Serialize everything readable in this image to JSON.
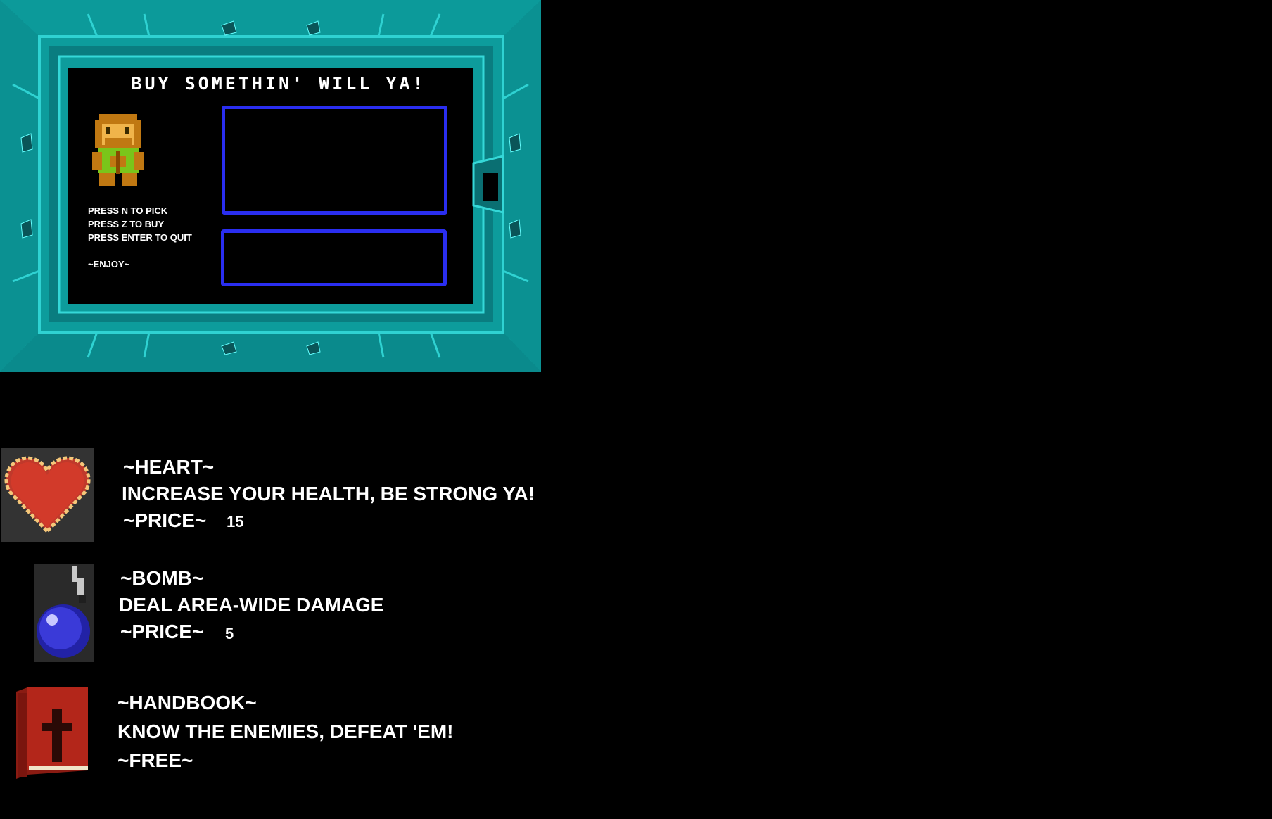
{
  "shop": {
    "title": "BUY SOMETHIN' WILL YA!",
    "controls": [
      "PRESS N TO PICK",
      "PRESS Z TO BUY",
      "PRESS ENTER TO QUIT"
    ],
    "enjoy": "~ENJOY~"
  },
  "colors": {
    "wall": "#0d9c9c",
    "wall_dark": "#0a6f72",
    "wall_light": "#2fd2d2",
    "frame_blue": "#2a2ef0"
  },
  "items": [
    {
      "name": "~HEART~",
      "description": "INCREASE YOUR HEALTH, BE STRONG YA!",
      "price_label": "~PRICE~",
      "price": "15",
      "icon": "heart-icon"
    },
    {
      "name": "~BOMB~",
      "description": "DEAL AREA-WIDE DAMAGE",
      "price_label": "~PRICE~",
      "price": "5",
      "icon": "bomb-icon"
    },
    {
      "name": "~HANDBOOK~",
      "description": "KNOW THE ENEMIES, DEFEAT 'EM!",
      "price_label": "~FREE~",
      "icon": "book-icon"
    }
  ]
}
